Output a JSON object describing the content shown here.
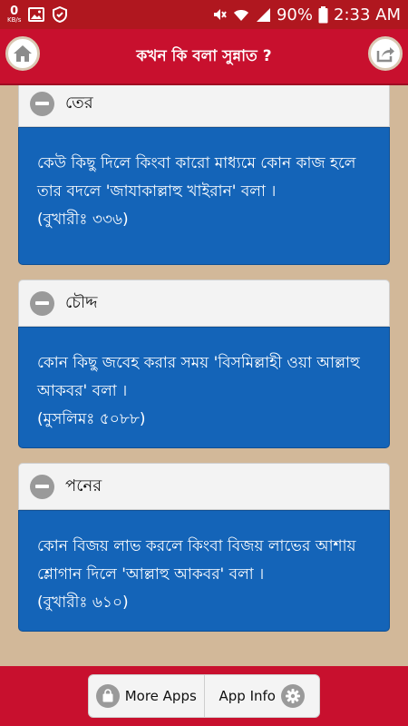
{
  "status_bar": {
    "data_speed_value": "0",
    "data_speed_unit": "KB/s",
    "battery": "90%",
    "time": "2:33 AM"
  },
  "app_bar": {
    "title": "কখন কি বলা সুন্নাত ?"
  },
  "cards": [
    {
      "title": "তের",
      "line1": "কেউ কিছু দিলে কিংবা কারো মাধ্যমে কোন কাজ হলে তার বদলে 'জাযাকাল্লাহু খাইরান' বলা ।",
      "reference": "(বুখারীঃ ৩৩৬)"
    },
    {
      "title": "চৌদ্দ",
      "line1": "কোন কিছু জবেহ করার সময় 'বিসমিল্লাহী ওয়া আল্লাহু আকবর' বলা ।",
      "reference": "(মুসলিমঃ ৫০৮৮)"
    },
    {
      "title": "পনের",
      "line1": "কোন বিজয় লাভ করলে কিংবা বিজয় লাভের আশায় শ্লোগান দিলে 'আল্লাহু আকবর' বলা ।",
      "reference": "(বুখারীঃ ৬১০)"
    }
  ],
  "footer": {
    "more_apps": "More Apps",
    "app_info": "App Info"
  },
  "colors": {
    "primary_red": "#c8102e",
    "card_blue": "#1464b8",
    "background_tan": "#d2b899"
  }
}
